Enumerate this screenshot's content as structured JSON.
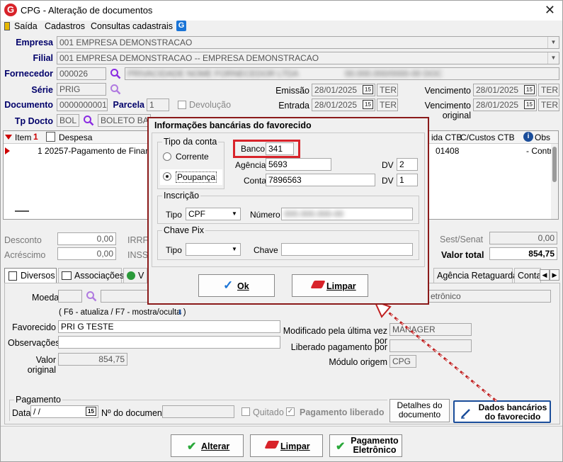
{
  "window": {
    "title": "CPG - Alteração de documentos"
  },
  "menu": {
    "saida": "Saída",
    "cadastros": "Cadastros",
    "consultas": "Consultas cadastrais"
  },
  "header": {
    "empresa_label": "Empresa",
    "empresa_value": "001 EMPRESA DEMONSTRACAO",
    "filial_label": "Filial",
    "filial_value": "001 EMPRESA DEMONSTRACAO -- EMPRESA DEMONSTRACAO",
    "fornecedor_label": "Fornecedor",
    "fornecedor_code": "000026",
    "fornecedor_name": "PRIVACIDADE NOME FORNECEDOR LTDA",
    "fornecedor_doc": "00.000.000/0000-00 DOC",
    "serie_label": "Série",
    "serie_value": "PRIG",
    "documento_label": "Documento",
    "documento_value": "0000000001",
    "parcela_label": "Parcela",
    "parcela_value": "1",
    "devolucao_label": "Devolução",
    "tpdocto_label": "Tp Docto",
    "tpdocto_code": "BOL",
    "tpdocto_name": "BOLETO BAN",
    "emissao_label": "Emissão",
    "emissao_value": "28/01/2025",
    "emissao_dow": "TER",
    "entrada_label": "Entrada",
    "entrada_value": "28/01/2025",
    "entrada_dow": "TER",
    "vencimento_label": "Vencimento",
    "vencimento_value": "28/01/2025",
    "vencimento_dow": "TER",
    "venc_original_label": "Vencimento original",
    "venc_original_value": "28/01/2025",
    "venc_original_dow": "TER"
  },
  "grid": {
    "col_item": "Item",
    "col_despesa": "Despesa",
    "col_ctb": "ida CTB",
    "col_ccustos": "C/Custos CTB",
    "col_obs": "Obs",
    "row_item": "1",
    "row_despesa": "20257-Pagamento de Financia",
    "row_ctb": "01408",
    "row_obs": "- Contra"
  },
  "totals": {
    "desconto_label": "Desconto",
    "desconto_value": "0,00",
    "acrescimo_label": "Acréscimo",
    "acrescimo_value": "0,00",
    "irrf_label": "IRRF",
    "inss_label": "INSS",
    "sest_label": "Sest/Senat",
    "sest_value": "0,00",
    "valor_total_label": "Valor total",
    "valor_total_value": "854,75"
  },
  "tabs": {
    "diversos": "Diversos",
    "associacoes": "Associações",
    "agencia": "Agência Retaguarda",
    "contab": "Contal"
  },
  "diversos": {
    "moeda_label": "Moeda",
    "pag_eletronico": "etrônico",
    "hint": "( F6 - atualiza / F7 - mostra/oculta )",
    "favorecido_label": "Favorecido",
    "favorecido_value": "PRI G TESTE",
    "observacoes_label": "Observações",
    "valor_original_label": "Valor original",
    "valor_original_value": "854,75",
    "modificado_label": "Modificado pela última vez por",
    "modificado_value": "MANAGER",
    "liberado_label": "Liberado pagamento por",
    "modulo_label": "Módulo origem",
    "modulo_value": "CPG",
    "pagamento_title": "Pagamento",
    "data_label": "Data",
    "data_value": " /  /",
    "ndoc_label": "Nº do documento",
    "quitado_label": "Quitado",
    "pag_liberado_label": "Pagamento liberado",
    "detalhes_btn": "Detalhes do documento",
    "dados_bancarios_btn": "Dados bancários do favorecido"
  },
  "bottom": {
    "alterar": "Alterar",
    "limpar": "Limpar",
    "pag_eletronico": "Pagamento Eletrônico"
  },
  "dialog": {
    "title": "Informações bancárias do favorecido",
    "tipo_conta_title": "Tipo da conta",
    "corrente": "Corrente",
    "poupanca": "Poupança",
    "banco_label": "Banco",
    "banco_value": "341",
    "agencia_label": "Agência",
    "agencia_value": "5693",
    "dv1_label": "DV",
    "dv1_value": "2",
    "conta_label": "Conta",
    "conta_value": "7896563",
    "dv2_label": "DV",
    "dv2_value": "1",
    "inscricao_title": "Inscrição",
    "tipo_label": "Tipo",
    "tipo_value": "CPF",
    "numero_label": "Número",
    "numero_value": "000.000.000-00",
    "pix_title": "Chave Pix",
    "pix_tipo_label": "Tipo",
    "chave_label": "Chave",
    "ok_btn": "Ok",
    "limpar_btn": "Limpar"
  }
}
